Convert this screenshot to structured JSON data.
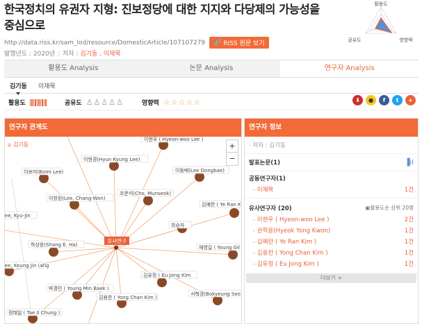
{
  "title": "한국정치의 유권자 지형: 진보정당에 대한 지지와 다당제의 가능성을 중심으로",
  "url": "http://data.riss.kr/sam_lod/resource/DomesticArticle/107107279",
  "riss_button": "RISS 원문 보기",
  "meta": {
    "year_label": "발행년도 : 2020년",
    "author_label": "저자 : ",
    "authors": "김기동 , 이재묵"
  },
  "radar": {
    "axes": [
      "활용도",
      "공유도",
      "영향력"
    ],
    "color": "#e8623a",
    "fill": "#5b8fd6"
  },
  "tabs": [
    "활용도 Analysis",
    "논문 Analysis",
    "연구자 Analysis"
  ],
  "subtabs": [
    "김기동",
    "이재묵"
  ],
  "stats": {
    "usage_label": "활용도",
    "share_label": "공유도",
    "influence_label": "영향력",
    "share_icons": "♙♙♙♙♙",
    "stars": "☆☆☆☆☆"
  },
  "left_panel": {
    "title": "연구자 관계도",
    "home_label": "김기동",
    "center_label": "유사연구",
    "nodes": [
      "이현우 ( Hyeon-woo Lee )",
      "이보미(Bomi Lee)",
      "이현경(Hyun Kyung Lee)",
      "이동배(Lee Dongbae)",
      "조문석(Cho, Munseok)",
      "이창원(Lee, Chang-Won)",
      "Lee, Kyu-Jin",
      "김예란 ( Ye Ran Kim",
      "최승자",
      "하상응(Shang E. Ha)",
      "채영길 ( Young Gil C",
      "Lee, Keung Jin (ang",
      "김유정 ( Eu Jong Kim",
      "박경민 ( Young Min Baek )",
      "김용찬 ( Yong Chan Kim )",
      "서혁경(Bokyeung Seo)",
      "정태일 ( Tae Il Chung )"
    ]
  },
  "right_panel": {
    "title": "연구자 정보",
    "author_line": "· 저자 : 김기동",
    "publications": "발표논문(1)",
    "coauthors_title": "공동연구자(1)",
    "coauthors": [
      {
        "name": "이재묵",
        "count": "1건"
      }
    ],
    "similar_title": "유사연구자 (20)",
    "similar_sort": "▣활용도순 상위 20명",
    "similar": [
      {
        "name": "이현우 ( Hyeon-woo Lee )",
        "count": "2건"
      },
      {
        "name": "권혁용(Hyeok Yong Kwon)",
        "count": "1건"
      },
      {
        "name": "김예란 ( Ye Ran Kim )",
        "count": "1건"
      },
      {
        "name": "김용찬 ( Yong Chan Kim )",
        "count": "1건"
      },
      {
        "name": "김유정 ( Eu Jong Kim )",
        "count": "1건"
      }
    ],
    "more": "더보기 +"
  }
}
